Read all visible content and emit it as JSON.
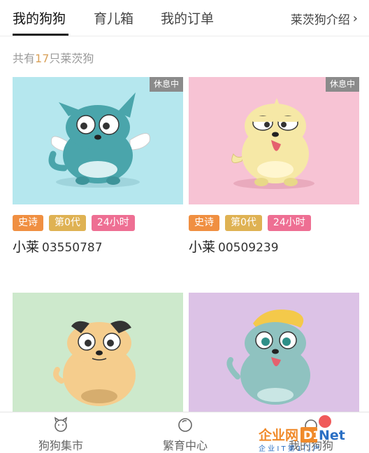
{
  "tabs": [
    {
      "label": "我的狗狗",
      "active": true
    },
    {
      "label": "育儿箱",
      "active": false
    },
    {
      "label": "我的订单",
      "active": false
    }
  ],
  "intro_link": "莱茨狗介绍",
  "count_line": {
    "prefix": "共有",
    "count": "17",
    "suffix": "只莱茨狗"
  },
  "dogs": [
    {
      "status": "休息中",
      "tags": [
        "史诗",
        "第0代",
        "24小时"
      ],
      "name_prefix": "小莱",
      "id": "03550787",
      "bg": "#b5e7ee",
      "body_color": "#4aa5ab"
    },
    {
      "status": "休息中",
      "tags": [
        "史诗",
        "第0代",
        "24小时"
      ],
      "name_prefix": "小莱",
      "id": "00509239",
      "bg": "#f7c3d4",
      "body_color": "#f6e8a6"
    },
    {
      "bg": "#cde9cc",
      "body_color": "#f5cd8d"
    },
    {
      "bg": "#dcc2e6",
      "body_color": "#8fc2c0"
    }
  ],
  "bottom_nav": [
    {
      "label": "狗狗集市",
      "icon": "dog-face-icon"
    },
    {
      "label": "繁育中心",
      "icon": "circle-icon"
    },
    {
      "label": "我的狗狗",
      "icon": "dog-icon"
    }
  ],
  "watermark": {
    "text": "企业网",
    "brand": "D1Net",
    "sub": "企 业 I T 第 1 门 户"
  }
}
